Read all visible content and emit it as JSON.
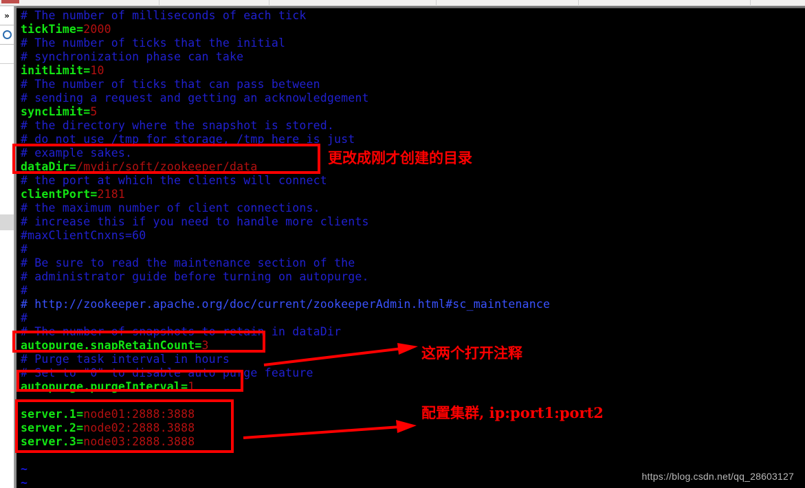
{
  "app": {
    "toolbar_accent_color": "#c0504d",
    "sidebar": {
      "chevron_label": "»",
      "circle_icon_name": "circle-icon"
    }
  },
  "terminal": {
    "background_color": "#000000",
    "comment_color": "#2020d0",
    "key_color": "#13e613",
    "value_color": "#b41010",
    "lines": [
      {
        "type": "comment",
        "text": "# The number of milliseconds of each tick"
      },
      {
        "type": "kv",
        "key": "tickTime=",
        "value": "2000"
      },
      {
        "type": "comment",
        "text": "# The number of ticks that the initial"
      },
      {
        "type": "comment",
        "text": "# synchronization phase can take"
      },
      {
        "type": "kv",
        "key": "initLimit=",
        "value": "10"
      },
      {
        "type": "comment",
        "text": "# The number of ticks that can pass between"
      },
      {
        "type": "comment",
        "text": "# sending a request and getting an acknowledgement"
      },
      {
        "type": "kv",
        "key": "syncLimit=",
        "value": "5"
      },
      {
        "type": "comment",
        "text": "# the directory where the snapshot is stored."
      },
      {
        "type": "comment",
        "text": "# do not use /tmp for storage, /tmp here is just"
      },
      {
        "type": "comment",
        "text": "# example sakes."
      },
      {
        "type": "kv",
        "key": "dataDir=",
        "value": "/mydir/soft/zookeeper/data"
      },
      {
        "type": "comment",
        "text": "# the port at which the clients will connect"
      },
      {
        "type": "kv",
        "key": "clientPort=",
        "value": "2181"
      },
      {
        "type": "comment",
        "text": "# the maximum number of client connections."
      },
      {
        "type": "comment",
        "text": "# increase this if you need to handle more clients"
      },
      {
        "type": "comment",
        "text": "#maxClientCnxns=60"
      },
      {
        "type": "comment",
        "text": "#"
      },
      {
        "type": "comment",
        "text": "# Be sure to read the maintenance section of the"
      },
      {
        "type": "comment",
        "text": "# administrator guide before turning on autopurge."
      },
      {
        "type": "comment",
        "text": "#"
      },
      {
        "type": "url",
        "text": "# http://zookeeper.apache.org/doc/current/zookeeperAdmin.html#sc_maintenance"
      },
      {
        "type": "comment",
        "text": "#"
      },
      {
        "type": "comment",
        "text": "# The number of snapshots to retain in dataDir"
      },
      {
        "type": "kv",
        "key": "autopurge.snapRetainCount=",
        "value": "3"
      },
      {
        "type": "comment",
        "text": "# Purge task interval in hours"
      },
      {
        "type": "comment",
        "text": "# Set to \"0\" to disable auto purge feature"
      },
      {
        "type": "kv",
        "key": "autopurge.purgeInterval=",
        "value": "1"
      },
      {
        "type": "blank",
        "text": ""
      },
      {
        "type": "kv",
        "key": "server.1=",
        "value": "node01:2888:3888"
      },
      {
        "type": "kv",
        "key": "server.2=",
        "value": "node02:2888.3888"
      },
      {
        "type": "kv",
        "key": "server.3=",
        "value": "node03:2888.3888"
      },
      {
        "type": "blank",
        "text": ""
      },
      {
        "type": "tilde",
        "text": "~"
      },
      {
        "type": "tilde",
        "text": "~"
      }
    ]
  },
  "annotations": {
    "color": "#fe0000",
    "notes": [
      {
        "id": "note-datadir",
        "text": "更改成刚才创建的目录"
      },
      {
        "id": "note-autopurge",
        "text": "这两个打开注释"
      },
      {
        "id": "note-servers",
        "text": "配置集群, ip:port1:port2"
      }
    ],
    "boxes": [
      {
        "id": "box-datadir",
        "target": "dataDir line"
      },
      {
        "id": "box-snapretaincount",
        "target": "autopurge.snapRetainCount line"
      },
      {
        "id": "box-purgeinterval",
        "target": "autopurge.purgeInterval line"
      },
      {
        "id": "box-servers",
        "target": "server.1 / server.2 / server.3 lines"
      }
    ]
  },
  "watermark": {
    "text": "https://blog.csdn.net/qq_28603127"
  }
}
